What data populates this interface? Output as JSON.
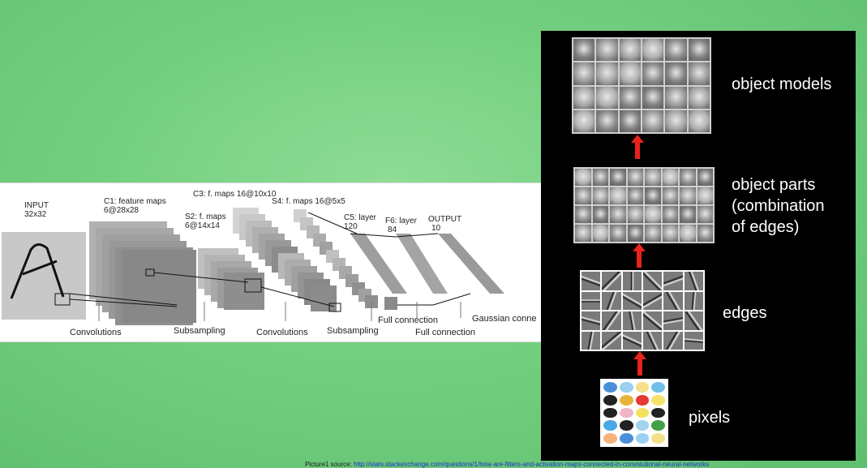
{
  "lenet": {
    "input": {
      "title": "INPUT",
      "size": "32x32"
    },
    "c1": {
      "title": "C1: feature maps",
      "size": "6@28x28"
    },
    "s2": {
      "title": "S2: f. maps",
      "size": "6@14x14"
    },
    "c3": {
      "title": "C3: f. maps 16@10x10"
    },
    "s4": {
      "title": "S4: f. maps 16@5x5"
    },
    "c5": {
      "title": "C5: layer",
      "size": "120"
    },
    "f6": {
      "title": "F6: layer",
      "size": "84"
    },
    "output": {
      "title": "OUTPUT",
      "size": "10"
    },
    "operations": [
      "Convolutions",
      "Subsampling",
      "Convolutions",
      "Subsampling",
      "Full connection",
      "Full connection",
      "Gaussian conne"
    ]
  },
  "hierarchy": {
    "levels": [
      "object models",
      "object parts (combination of edges)",
      "edges",
      "pixels"
    ],
    "object_models": "object models",
    "object_parts_line1": "object parts",
    "object_parts_line2": "(combination",
    "object_parts_line3": "of edges)",
    "edges": "edges",
    "pixels": "pixels",
    "pixel_colors": [
      "#4a90d9",
      "#9ad0f0",
      "#f3e08a",
      "#6fc0e8",
      "#222222",
      "#e8b33c",
      "#e53935",
      "#f5e26b",
      "#222222",
      "#f0b6c8",
      "#f2e25a",
      "#222222",
      "#4aa7e8",
      "#222222",
      "#9fd3f0",
      "#43a047",
      "#f5b27a"
    ],
    "arrow_color": "#e8231c"
  },
  "credit": {
    "prefix": "Picture1 source: ",
    "link": "http://stats.stackexchange.com/questions/1/how-are-filters-and-activation-maps-connected-in-convolutional-neural-networks"
  }
}
